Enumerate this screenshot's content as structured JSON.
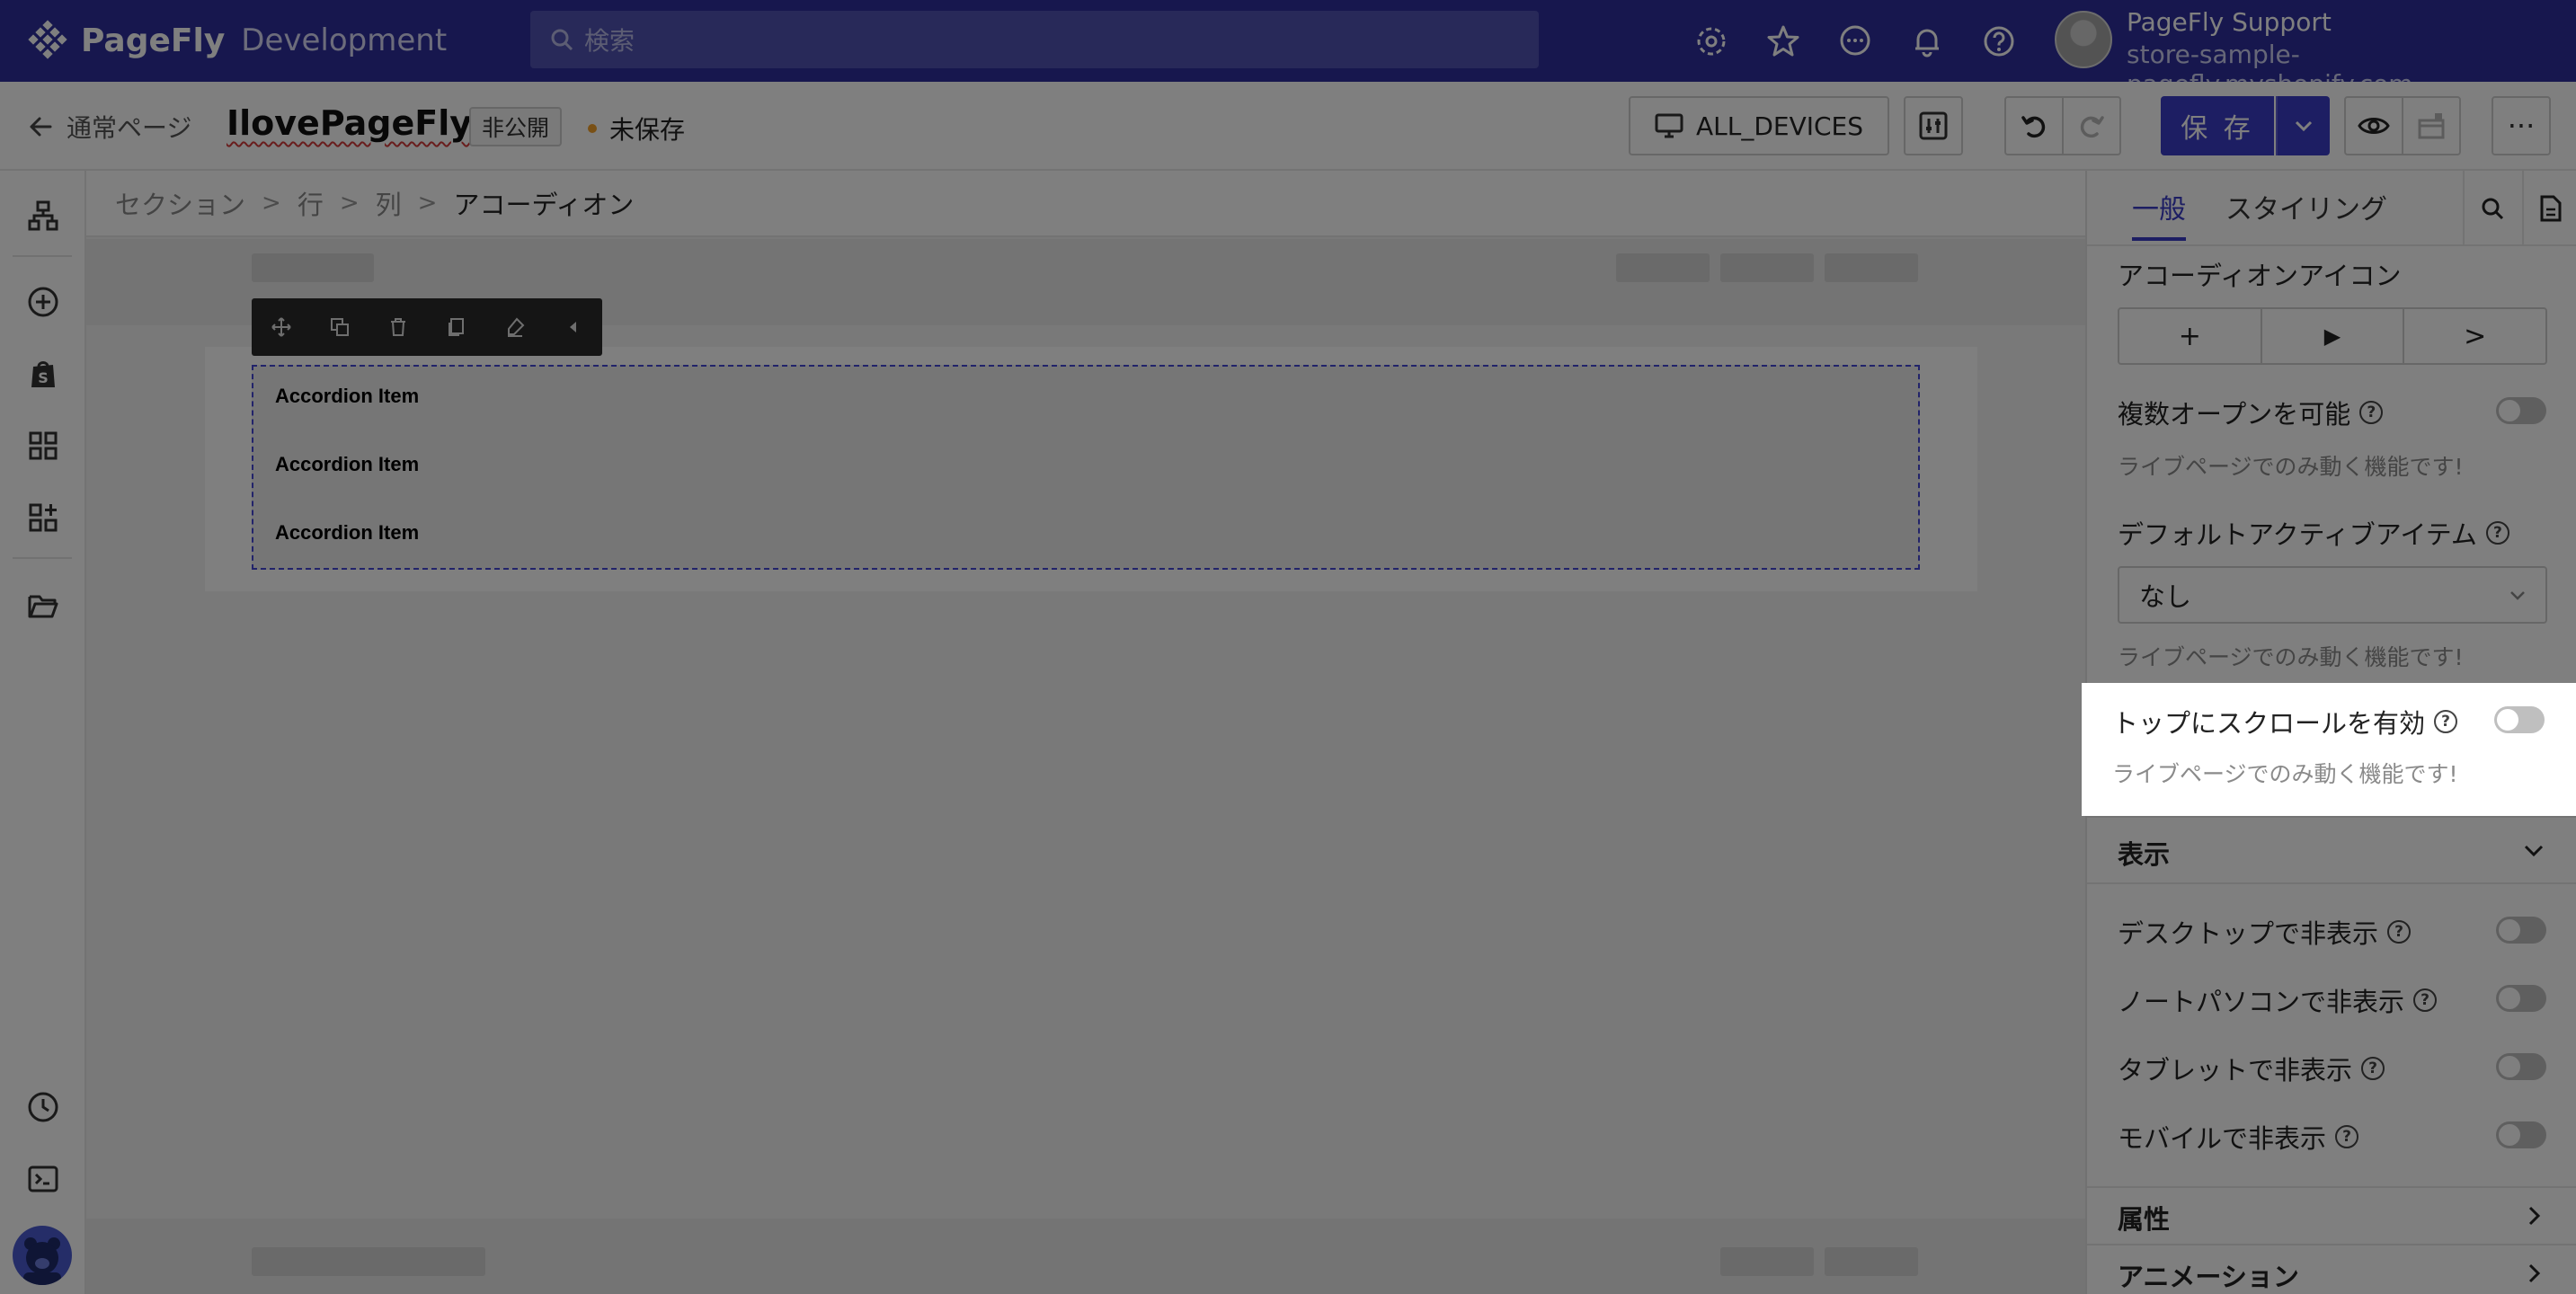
{
  "topbar": {
    "brand": "PageFly",
    "environment": "Development",
    "search_placeholder": "検索",
    "icons": [
      "settings-gear-icon",
      "star-icon",
      "chat-icon",
      "bell-icon",
      "help-icon"
    ],
    "user": {
      "name": "PageFly Support",
      "store": "store-sample-pagefly.myshopify.com"
    }
  },
  "toolbar": {
    "back_label": "通常ページ",
    "page_title": "IlovePageFly",
    "status_badge": "非公開",
    "unsaved_label": "未保存",
    "device_label": "ALL_DEVICES",
    "save_label": "保 存",
    "more_label": "···"
  },
  "breadcrumb": [
    "セクション",
    "行",
    "列",
    "アコーディオン"
  ],
  "canvas": {
    "accordion_items": [
      "Accordion Item",
      "Accordion Item",
      "Accordion Item"
    ]
  },
  "right_panel": {
    "tabs": {
      "general": "一般",
      "styling": "スタイリング"
    },
    "accordion_icon_label": "アコーディオンアイコン",
    "icon_options": [
      "+",
      "▶",
      ">"
    ],
    "multi_open": {
      "label": "複数オープンを可能",
      "hint": "ライブページでのみ動く機能です!",
      "enabled": false
    },
    "default_active": {
      "label": "デフォルトアクティブアイテム",
      "value": "なし",
      "hint": "ライブページでのみ動く機能です!"
    },
    "scroll_top": {
      "label": "トップにスクロールを有効",
      "hint": "ライブページでのみ動く機能です!",
      "enabled": false
    },
    "display_section": {
      "title": "表示",
      "items": [
        {
          "label": "デスクトップで非表示",
          "enabled": false
        },
        {
          "label": "ノートパソコンで非表示",
          "enabled": false
        },
        {
          "label": "タブレットで非表示",
          "enabled": false
        },
        {
          "label": "モバイルで非表示",
          "enabled": false
        }
      ]
    },
    "attributes_section": "属性",
    "animation_section": "アニメーション"
  },
  "colors": {
    "topbar": "#2e2f9d",
    "accent": "#3b3cc6",
    "unsaved_dot": "#f2a12b"
  }
}
